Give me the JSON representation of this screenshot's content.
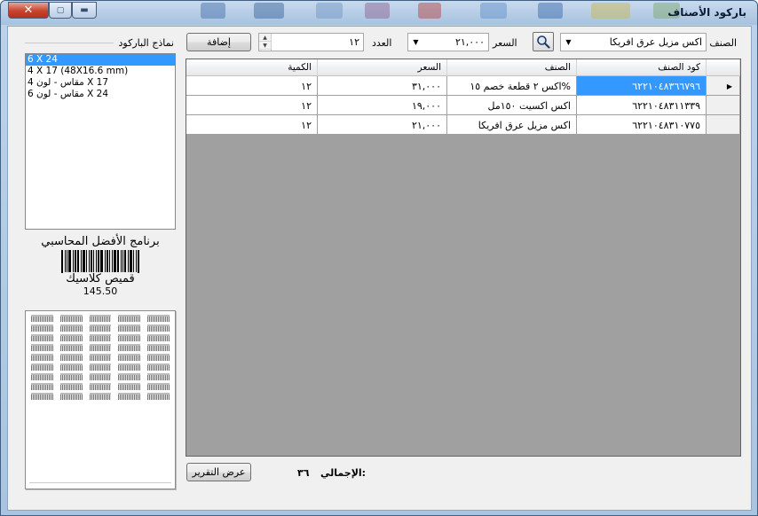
{
  "window": {
    "title": "باركود الأصناف",
    "close_glyph": "✕",
    "maximize_glyph": "▢",
    "minimize_glyph": "▬"
  },
  "templates": {
    "label": "نماذج الباركود",
    "items": [
      "6 X 24",
      "4 X 17 (48X16.6 mm)",
      "مقاس - لون 4 X 17",
      "مقاس - لون 6 X 24"
    ],
    "selected_index": 0
  },
  "label_preview": {
    "company": "برنامج الأفضل المحاسبي",
    "item_name": "قميص كلاسيك",
    "price": "145.50"
  },
  "form": {
    "item_label": "الصنف",
    "item_value": "اكس مزيل عرق افريكا",
    "price_label": "السعر",
    "price_value": "٢١,٠٠٠",
    "count_label": "العدد",
    "count_value": "١٢",
    "add_button": "إضافة"
  },
  "grid": {
    "columns": [
      "كود الصنف",
      "الصنف",
      "السعر",
      "الكمية"
    ],
    "rows": [
      {
        "code": "٦٢٢١٠٤٨٣٦٦٧٩٦",
        "name": "اكس ٢ قطعة خصم ١٥%",
        "price": "٣١,٠٠٠",
        "qty": "١٢"
      },
      {
        "code": "٦٢٢١٠٤٨٣١١٣٣٩",
        "name": "اكس اكسيت ١٥٠مل",
        "price": "١٩,٠٠٠",
        "qty": "١٢"
      },
      {
        "code": "٦٢٢١٠٤٨٣١٠٧٧٥",
        "name": "اكس مزيل عرق افريكا",
        "price": "٢١,٠٠٠",
        "qty": "١٢"
      }
    ],
    "current_row_glyph": "▶"
  },
  "footer": {
    "total_label": "الإجمالي:",
    "total_value": "٣٦",
    "report_button": "عرض التقرير"
  },
  "colors": {
    "selection": "#3399ff",
    "grid_background": "#a0a0a0",
    "close_button": "#c7432b"
  }
}
